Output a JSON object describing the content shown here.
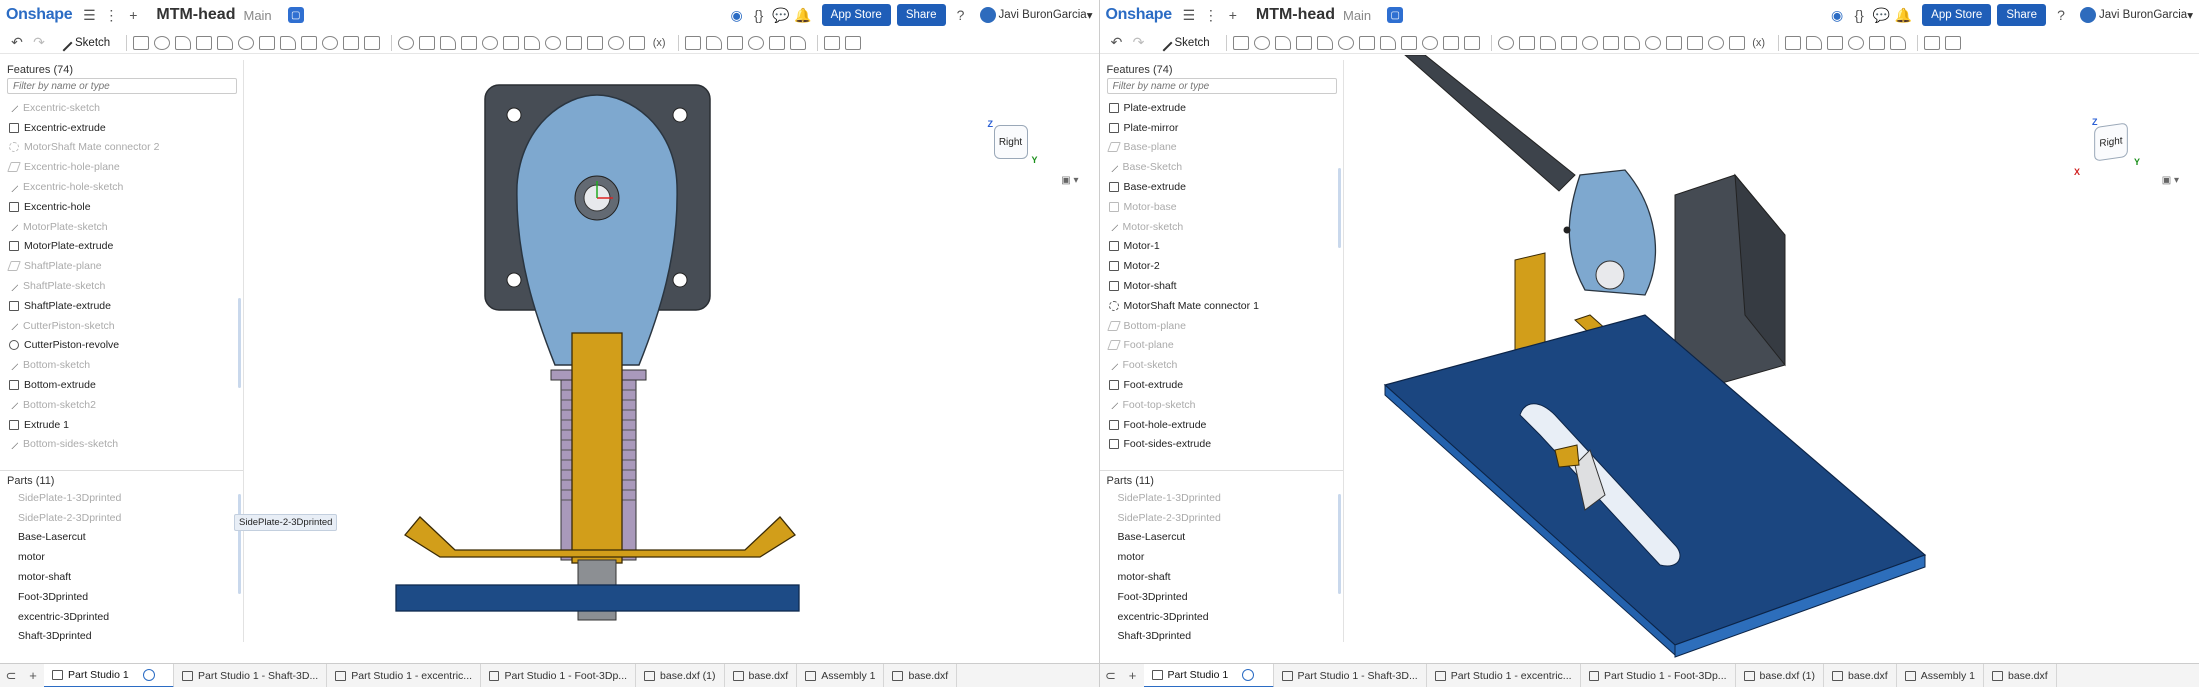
{
  "left": {
    "app": {
      "logo": "Onshape",
      "doc_name": "MTM-head",
      "branch": "Main",
      "app_store": "App Store",
      "share": "Share",
      "user": "Javi BuronGarcia"
    },
    "toolbar": {
      "sketch": "Sketch"
    },
    "features": {
      "title": "Features (74)",
      "filter_placeholder": "Filter by name or type",
      "items": [
        {
          "label": "Excentric-sketch",
          "type": "sketch",
          "dim": true
        },
        {
          "label": "Excentric-extrude",
          "type": "extrude",
          "dim": false
        },
        {
          "label": "MotorShaft Mate connector 2",
          "type": "mate",
          "dim": true
        },
        {
          "label": "Excentric-hole-plane",
          "type": "plane",
          "dim": true
        },
        {
          "label": "Excentric-hole-sketch",
          "type": "sketch",
          "dim": true
        },
        {
          "label": "Excentric-hole",
          "type": "hole",
          "dim": false
        },
        {
          "label": "MotorPlate-sketch",
          "type": "sketch",
          "dim": true
        },
        {
          "label": "MotorPlate-extrude",
          "type": "extrude",
          "dim": false
        },
        {
          "label": "ShaftPlate-plane",
          "type": "plane",
          "dim": true
        },
        {
          "label": "ShaftPlate-sketch",
          "type": "sketch",
          "dim": true
        },
        {
          "label": "ShaftPlate-extrude",
          "type": "extrude",
          "dim": false
        },
        {
          "label": "CutterPiston-sketch",
          "type": "sketch",
          "dim": true
        },
        {
          "label": "CutterPiston-revolve",
          "type": "revolve",
          "dim": false
        },
        {
          "label": "Bottom-sketch",
          "type": "sketch",
          "dim": true
        },
        {
          "label": "Bottom-extrude",
          "type": "extrude",
          "dim": false
        },
        {
          "label": "Bottom-sketch2",
          "type": "sketch",
          "dim": true
        },
        {
          "label": "Extrude 1",
          "type": "extrude",
          "dim": false
        },
        {
          "label": "Bottom-sides-sketch",
          "type": "sketch",
          "dim": true
        }
      ]
    },
    "parts": {
      "title": "Parts (11)",
      "items": [
        {
          "label": "SidePlate-1-3Dprinted",
          "dim": true
        },
        {
          "label": "SidePlate-2-3Dprinted",
          "dim": true
        },
        {
          "label": "Base-Lasercut",
          "dim": false
        },
        {
          "label": "motor",
          "dim": false
        },
        {
          "label": "motor-shaft",
          "dim": false
        },
        {
          "label": "Foot-3Dprinted",
          "dim": false
        },
        {
          "label": "excentric-3Dprinted",
          "dim": false
        },
        {
          "label": "Shaft-3Dprinted",
          "dim": false
        }
      ],
      "tooltip": "SidePlate-2-3Dprinted"
    },
    "viewcube": {
      "face": "Right",
      "axis_z": "Z",
      "axis_y": "Y"
    },
    "tabs": [
      {
        "label": "Part Studio 1",
        "active": true
      },
      {
        "label": "Part Studio 1 - Shaft-3D...",
        "active": false
      },
      {
        "label": "Part Studio 1 - excentric...",
        "active": false
      },
      {
        "label": "Part Studio 1 - Foot-3Dp...",
        "active": false
      },
      {
        "label": "base.dxf (1)",
        "active": false
      },
      {
        "label": "base.dxf",
        "active": false
      },
      {
        "label": "Assembly 1",
        "active": false
      },
      {
        "label": "base.dxf",
        "active": false
      }
    ]
  },
  "right": {
    "app": {
      "logo": "Onshape",
      "doc_name": "MTM-head",
      "branch": "Main",
      "app_store": "App Store",
      "share": "Share",
      "user": "Javi BuronGarcia"
    },
    "toolbar": {
      "sketch": "Sketch"
    },
    "features": {
      "title": "Features (74)",
      "filter_placeholder": "Filter by name or type",
      "items": [
        {
          "label": "Plate-extrude",
          "type": "extrude",
          "dim": false
        },
        {
          "label": "Plate-mirror",
          "type": "mirror",
          "dim": false
        },
        {
          "label": "Base-plane",
          "type": "plane",
          "dim": true
        },
        {
          "label": "Base-Sketch",
          "type": "sketch",
          "dim": true
        },
        {
          "label": "Base-extrude",
          "type": "extrude",
          "dim": false
        },
        {
          "label": "Motor-base",
          "type": "extrude",
          "dim": true
        },
        {
          "label": "Motor-sketch",
          "type": "sketch",
          "dim": true
        },
        {
          "label": "Motor-1",
          "type": "extrude",
          "dim": false
        },
        {
          "label": "Motor-2",
          "type": "extrude",
          "dim": false
        },
        {
          "label": "Motor-shaft",
          "type": "extrude",
          "dim": false
        },
        {
          "label": "MotorShaft Mate connector 1",
          "type": "mate",
          "dim": false
        },
        {
          "label": "Bottom-plane",
          "type": "plane",
          "dim": true
        },
        {
          "label": "Foot-plane",
          "type": "plane",
          "dim": true
        },
        {
          "label": "Foot-sketch",
          "type": "sketch",
          "dim": true
        },
        {
          "label": "Foot-extrude",
          "type": "extrude",
          "dim": false
        },
        {
          "label": "Foot-top-sketch",
          "type": "sketch",
          "dim": true
        },
        {
          "label": "Foot-hole-extrude",
          "type": "extrude",
          "dim": false
        },
        {
          "label": "Foot-sides-extrude",
          "type": "extrude",
          "dim": false
        }
      ]
    },
    "parts": {
      "title": "Parts (11)",
      "items": [
        {
          "label": "SidePlate-1-3Dprinted",
          "dim": true
        },
        {
          "label": "SidePlate-2-3Dprinted",
          "dim": true
        },
        {
          "label": "Base-Lasercut",
          "dim": false
        },
        {
          "label": "motor",
          "dim": false
        },
        {
          "label": "motor-shaft",
          "dim": false
        },
        {
          "label": "Foot-3Dprinted",
          "dim": false
        },
        {
          "label": "excentric-3Dprinted",
          "dim": false
        },
        {
          "label": "Shaft-3Dprinted",
          "dim": false
        }
      ]
    },
    "viewcube": {
      "face": "Right",
      "axis_z": "Z",
      "axis_y": "Y",
      "axis_x": "X"
    },
    "tabs": [
      {
        "label": "Part Studio 1",
        "active": true
      },
      {
        "label": "Part Studio 1 - Shaft-3D...",
        "active": false
      },
      {
        "label": "Part Studio 1 - excentric...",
        "active": false
      },
      {
        "label": "Part Studio 1 - Foot-3Dp...",
        "active": false
      },
      {
        "label": "base.dxf (1)",
        "active": false
      },
      {
        "label": "base.dxf",
        "active": false
      },
      {
        "label": "Assembly 1",
        "active": false
      },
      {
        "label": "base.dxf",
        "active": false
      }
    ]
  },
  "colors": {
    "brand": "#2b6cc4",
    "button": "#1f5eb8",
    "motor_dark": "#4a5058",
    "part_light_blue": "#7fa9cf",
    "part_gold": "#d29e1a",
    "base_blue": "#1d4b86"
  }
}
